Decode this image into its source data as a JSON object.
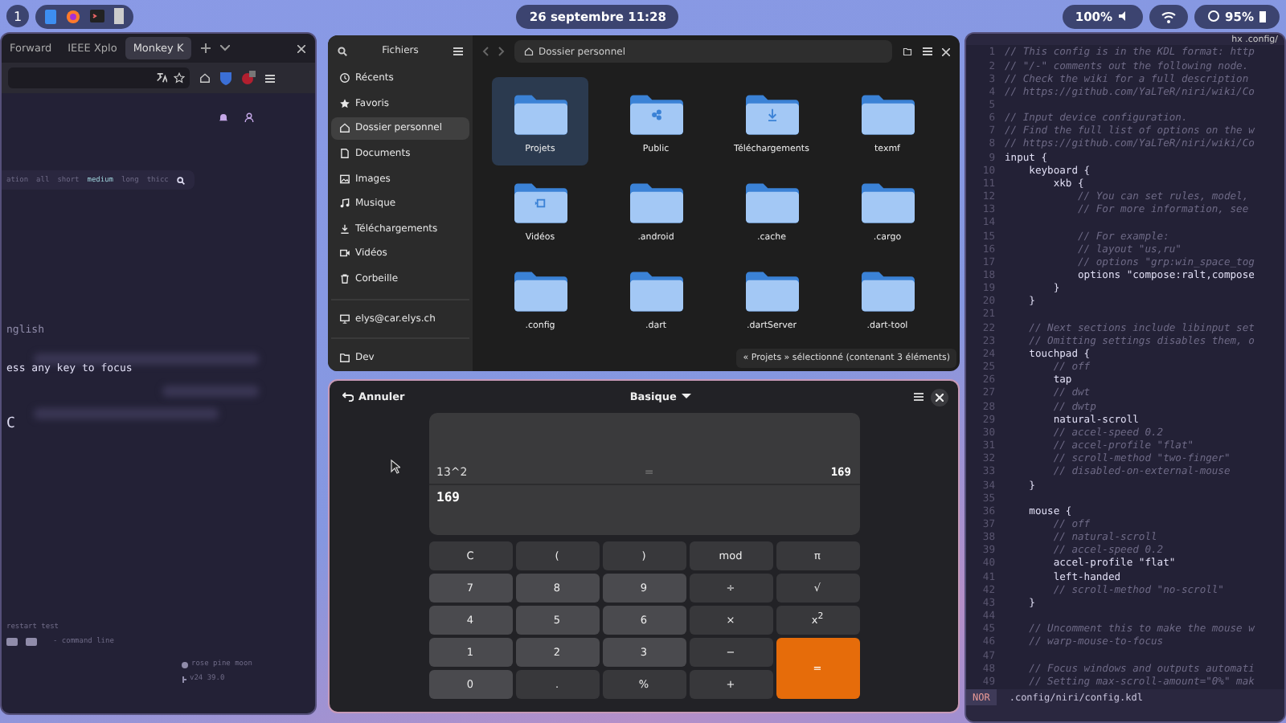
{
  "top_bar": {
    "workspace": "1",
    "clock": "26 septembre 11:28",
    "volume": "100%",
    "battery": "95%"
  },
  "browser": {
    "tabs": [
      {
        "label": "Forward",
        "selected": false
      },
      {
        "label": "IEEE Xplo",
        "selected": false
      },
      {
        "label": "Monkey K",
        "selected": true
      }
    ],
    "modes": [
      {
        "label": "ation",
        "selected": false
      },
      {
        "label": "all",
        "selected": false
      },
      {
        "label": "short",
        "selected": false
      },
      {
        "label": "medium",
        "selected": true
      },
      {
        "label": "long",
        "selected": false
      },
      {
        "label": "thicc",
        "selected": false
      }
    ],
    "language": "nglish",
    "focus_hint": "ess any key to focus",
    "caps": "C",
    "restart_hint": "restart test",
    "command_hint": "- command line",
    "theme": "rose pine moon",
    "version": "v24 39.0"
  },
  "files": {
    "title": "Fichiers",
    "path": "Dossier personnel",
    "sidebar": [
      {
        "label": "Récents",
        "selected": false
      },
      {
        "label": "Favoris",
        "selected": false
      },
      {
        "label": "Dossier personnel",
        "selected": true
      },
      {
        "label": "Documents",
        "selected": false
      },
      {
        "label": "Images",
        "selected": false
      },
      {
        "label": "Musique",
        "selected": false
      },
      {
        "label": "Téléchargements",
        "selected": false
      },
      {
        "label": "Vidéos",
        "selected": false
      },
      {
        "label": "Corbeille",
        "selected": false
      },
      {
        "label": "elys@car.elys.ch",
        "selected": false
      },
      {
        "label": "Dev",
        "selected": false
      }
    ],
    "items": [
      {
        "name": "Projets",
        "selected": true
      },
      {
        "name": "Public",
        "selected": false
      },
      {
        "name": "Téléchargements",
        "selected": false
      },
      {
        "name": "texmf",
        "selected": false
      },
      {
        "name": "Vidéos",
        "selected": false
      },
      {
        "name": ".android",
        "selected": false
      },
      {
        "name": ".cache",
        "selected": false
      },
      {
        "name": ".cargo",
        "selected": false
      },
      {
        "name": ".config",
        "selected": false
      },
      {
        "name": ".dart",
        "selected": false
      },
      {
        "name": ".dartServer",
        "selected": false
      },
      {
        "name": ".dart-tool",
        "selected": false
      }
    ],
    "status": "« Projets » sélectionné (contenant 3 éléments)"
  },
  "calculator": {
    "back": "Annuler",
    "mode": "Basique",
    "expression": "13^2",
    "equals": "=",
    "result": "169",
    "input": "169",
    "keys": [
      {
        "label": "C",
        "kind": "op"
      },
      {
        "label": "(",
        "kind": "op"
      },
      {
        "label": ")",
        "kind": "op"
      },
      {
        "label": "mod",
        "kind": "op"
      },
      {
        "label": "π",
        "kind": "op"
      },
      {
        "label": "7",
        "kind": "digit"
      },
      {
        "label": "8",
        "kind": "digit"
      },
      {
        "label": "9",
        "kind": "digit"
      },
      {
        "label": "÷",
        "kind": "op"
      },
      {
        "label": "√",
        "kind": "op"
      },
      {
        "label": "4",
        "kind": "digit"
      },
      {
        "label": "5",
        "kind": "digit"
      },
      {
        "label": "6",
        "kind": "digit"
      },
      {
        "label": "×",
        "kind": "op"
      },
      {
        "label": "x$^{2}$",
        "kind": "op"
      },
      {
        "label": "1",
        "kind": "digit"
      },
      {
        "label": "2",
        "kind": "digit"
      },
      {
        "label": "3",
        "kind": "digit"
      },
      {
        "label": "−",
        "kind": "op"
      },
      {
        "label": "=",
        "kind": "equals"
      },
      {
        "label": "0",
        "kind": "digit"
      },
      {
        "label": ".",
        "kind": "op"
      },
      {
        "label": "%",
        "kind": "op"
      },
      {
        "label": "+",
        "kind": "op"
      }
    ]
  },
  "editor": {
    "title": "hx .config/",
    "mode": "NOR",
    "file": ".config/niri/config.kdl",
    "lines": [
      {
        "n": "1",
        "text": "// This config is in the KDL format: http",
        "kind": "comment"
      },
      {
        "n": "2",
        "text": "// \"/-\" comments out the following node.",
        "kind": "comment"
      },
      {
        "n": "3",
        "text": "// Check the wiki for a full description",
        "kind": "comment"
      },
      {
        "n": "4",
        "text": "// https://github.com/YaLTeR/niri/wiki/Co",
        "kind": "comment"
      },
      {
        "n": "5",
        "kind": "blank"
      },
      {
        "n": "6",
        "text": "// Input device configuration.",
        "kind": "comment"
      },
      {
        "n": "7",
        "text": "// Find the full list of options on the w",
        "kind": "comment"
      },
      {
        "n": "8",
        "text": "// https://github.com/YaLTeR/niri/wiki/Co",
        "kind": "comment"
      },
      {
        "n": "9",
        "text": "input {",
        "kind": "code"
      },
      {
        "n": "10",
        "text": "    keyboard {",
        "kind": "code"
      },
      {
        "n": "11",
        "text": "        xkb {",
        "kind": "code"
      },
      {
        "n": "12",
        "text": "            // You can set rules, model,",
        "kind": "comment"
      },
      {
        "n": "13",
        "text": "            // For more information, see",
        "kind": "comment"
      },
      {
        "n": "14",
        "kind": "blank"
      },
      {
        "n": "15",
        "text": "            // For example:",
        "kind": "comment"
      },
      {
        "n": "16",
        "text": "            // layout \"us,ru\"",
        "kind": "comment"
      },
      {
        "n": "17",
        "text": "            // options \"grp:win_space_tog",
        "kind": "comment"
      },
      {
        "n": "18",
        "text": "            options \"compose:ralt,compose",
        "kind": "code"
      },
      {
        "n": "19",
        "text": "        }",
        "kind": "code"
      },
      {
        "n": "20",
        "text": "    }",
        "kind": "code"
      },
      {
        "n": "21",
        "kind": "blank"
      },
      {
        "n": "22",
        "text": "    // Next sections include libinput set",
        "kind": "comment"
      },
      {
        "n": "23",
        "text": "    // Omitting settings disables them, o",
        "kind": "comment"
      },
      {
        "n": "24",
        "text": "    touchpad {",
        "kind": "code"
      },
      {
        "n": "25",
        "text": "        // off",
        "kind": "comment"
      },
      {
        "n": "26",
        "text": "        tap",
        "kind": "code"
      },
      {
        "n": "27",
        "text": "        // dwt",
        "kind": "comment"
      },
      {
        "n": "28",
        "text": "        // dwtp",
        "kind": "comment"
      },
      {
        "n": "29",
        "text": "        natural-scroll",
        "kind": "code"
      },
      {
        "n": "30",
        "text": "        // accel-speed 0.2",
        "kind": "comment"
      },
      {
        "n": "31",
        "text": "        // accel-profile \"flat\"",
        "kind": "comment"
      },
      {
        "n": "32",
        "text": "        // scroll-method \"two-finger\"",
        "kind": "comment"
      },
      {
        "n": "33",
        "text": "        // disabled-on-external-mouse",
        "kind": "comment"
      },
      {
        "n": "34",
        "text": "    }",
        "kind": "code"
      },
      {
        "n": "35",
        "kind": "blank"
      },
      {
        "n": "36",
        "text": "    mouse {",
        "kind": "code"
      },
      {
        "n": "37",
        "text": "        // off",
        "kind": "comment"
      },
      {
        "n": "38",
        "text": "        // natural-scroll",
        "kind": "comment"
      },
      {
        "n": "39",
        "text": "        // accel-speed 0.2",
        "kind": "comment"
      },
      {
        "n": "40",
        "text": "        accel-profile \"flat\"",
        "kind": "code"
      },
      {
        "n": "41",
        "text": "        left-handed",
        "kind": "code"
      },
      {
        "n": "42",
        "text": "        // scroll-method \"no-scroll\"",
        "kind": "comment"
      },
      {
        "n": "43",
        "text": "    }",
        "kind": "code"
      },
      {
        "n": "44",
        "kind": "blank"
      },
      {
        "n": "45",
        "text": "    // Uncomment this to make the mouse w",
        "kind": "comment"
      },
      {
        "n": "46",
        "text": "    // warp-mouse-to-focus",
        "kind": "comment"
      },
      {
        "n": "47",
        "kind": "blank"
      },
      {
        "n": "48",
        "text": "    // Focus windows and outputs automati",
        "kind": "comment"
      },
      {
        "n": "49",
        "text": "    // Setting max-scroll-amount=\"0%\" mak",
        "kind": "comment"
      }
    ]
  }
}
